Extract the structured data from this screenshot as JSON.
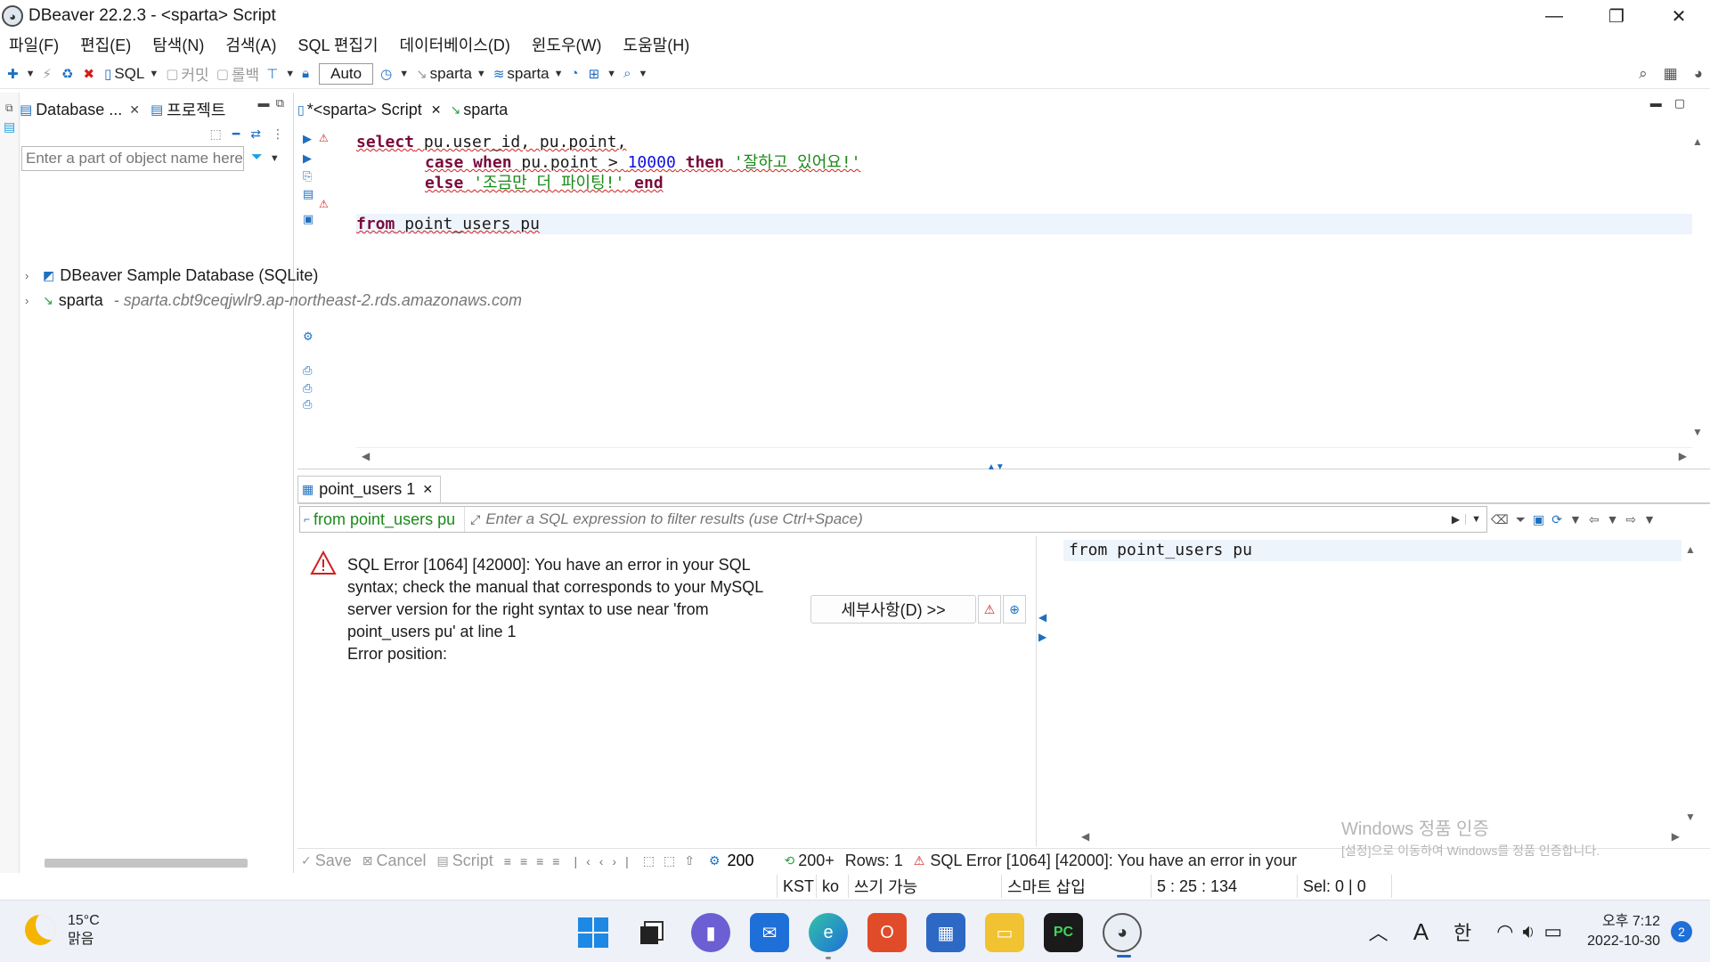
{
  "window": {
    "title": "DBeaver 22.2.3 - <sparta> Script",
    "controls": [
      "—",
      "❐",
      "✕"
    ]
  },
  "menu": [
    "파일(F)",
    "편집(E)",
    "탐색(N)",
    "검색(A)",
    "SQL 편집기",
    "데이터베이스(D)",
    "윈도우(W)",
    "도움말(H)"
  ],
  "toolbar": {
    "sql_label": "SQL",
    "commit_label": "커밋",
    "rollback_label": "롤백",
    "transaction_mode": "Auto",
    "datasource_label": "sparta",
    "schema_label": "sparta"
  },
  "left_panel": {
    "tab_database": "Database ...",
    "tab_project": "프로젝트",
    "search_placeholder": "Enter a part of object name here",
    "tree": [
      {
        "label": "DBeaver Sample Database (SQLite)",
        "sub": ""
      },
      {
        "label": "sparta",
        "sub": "- sparta.cbt9ceqjwlr9.ap-northeast-2.rds.amazonaws.com"
      }
    ]
  },
  "editor": {
    "tab_script": "*<sparta> Script",
    "tab_sparta": "sparta",
    "code": {
      "l1_kw": "select",
      "l1_rest": " pu.user_id, pu.point,",
      "l2_kw1": "case when",
      "l2_mid": " pu.point > ",
      "l2_num": "10000",
      "l2_kw2": " then ",
      "l2_str": "'잘하고 있어요!'",
      "l3_kw": "else",
      "l3_str": " '조금만 더 파이팅!'",
      "l3_kw2": " end",
      "l5_kw": "from",
      "l5_rest": " point_users pu"
    }
  },
  "results": {
    "tab_label": "point_users 1",
    "filter_query": "from point_users pu",
    "filter_placeholder": "Enter a SQL expression to filter results (use Ctrl+Space)",
    "error_message": "SQL Error [1064] [42000]: You have an error in your SQL syntax; check the manual that corresponds to your MySQL server version for the right syntax to use near 'from point_users pu' at line 1",
    "error_position": "Error position:",
    "details_button": "세부사항(D) >>",
    "query_text": "from point_users pu",
    "bottom": {
      "save": "Save",
      "cancel": "Cancel",
      "script": "Script",
      "fetch_size": "200",
      "fetch_next": "200+",
      "rows": "Rows: 1",
      "status_error": "SQL Error [1064] [42000]: You have an error in your"
    }
  },
  "watermark": {
    "line1": "Windows 정품 인증",
    "line2": "[설정]으로 이동하여 Windows를 정품 인증합니다."
  },
  "statusbar": {
    "timezone": "KST",
    "locale": "ko",
    "write_mode": "쓰기 가능",
    "insert_mode": "스마트 삽입",
    "cursor": "5 : 25 : 134",
    "selection": "Sel: 0 | 0"
  },
  "taskbar": {
    "weather_temp": "15°C",
    "weather_desc": "맑음",
    "ime_a": "A",
    "ime_lang": "한",
    "time": "오후 7:12",
    "date": "2022-10-30",
    "notifications": "2"
  }
}
